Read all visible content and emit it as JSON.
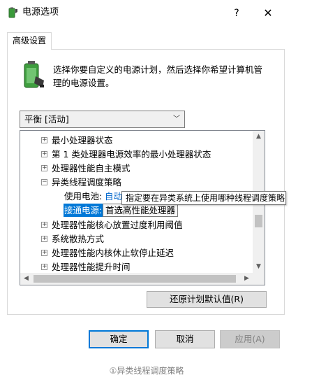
{
  "window": {
    "title": "电源选项",
    "help_glyph": "?",
    "close_glyph": "✕"
  },
  "tabs": [
    {
      "label": "高级设置"
    }
  ],
  "intro_text": "选择你要自定义的电源计划，然后选择你希望计算机管理的电源设置。",
  "plan_select": {
    "value": "平衡 [活动]"
  },
  "tree": {
    "items": [
      {
        "label": "最小处理器状态",
        "expander": "⊞"
      },
      {
        "label": "第 1 类处理器电源效率的最小处理器状态",
        "expander": "⊞"
      },
      {
        "label": "处理器性能自主模式",
        "expander": "⊞"
      },
      {
        "label": "异类线程调度策略",
        "expander": "⊟"
      },
      {
        "label": "处理器性能核心放置过度利用阈值",
        "expander": "⊞"
      },
      {
        "label": "系统散热方式",
        "expander": "⊞"
      },
      {
        "label": "处理器性能内核休止软停止延迟",
        "expander": "⊞"
      },
      {
        "label": "处理器性能提升时间",
        "expander": "⊞"
      }
    ],
    "battery_label": "使用电池:",
    "battery_value": "自动",
    "plugged_label": "接通电源:",
    "plugged_value": "首选高性能处理器"
  },
  "tooltip": "指定要在异类系统上使用哪种线程调度策略",
  "buttons": {
    "restore": "还原计划默认值(R)",
    "ok": "确定",
    "cancel": "取消",
    "apply": "应用(A)"
  },
  "caption": "①异类线程调度策略",
  "colors": {
    "selection": "#0078d7",
    "link_value": "#0066cc",
    "disabled_text": "#838383"
  }
}
